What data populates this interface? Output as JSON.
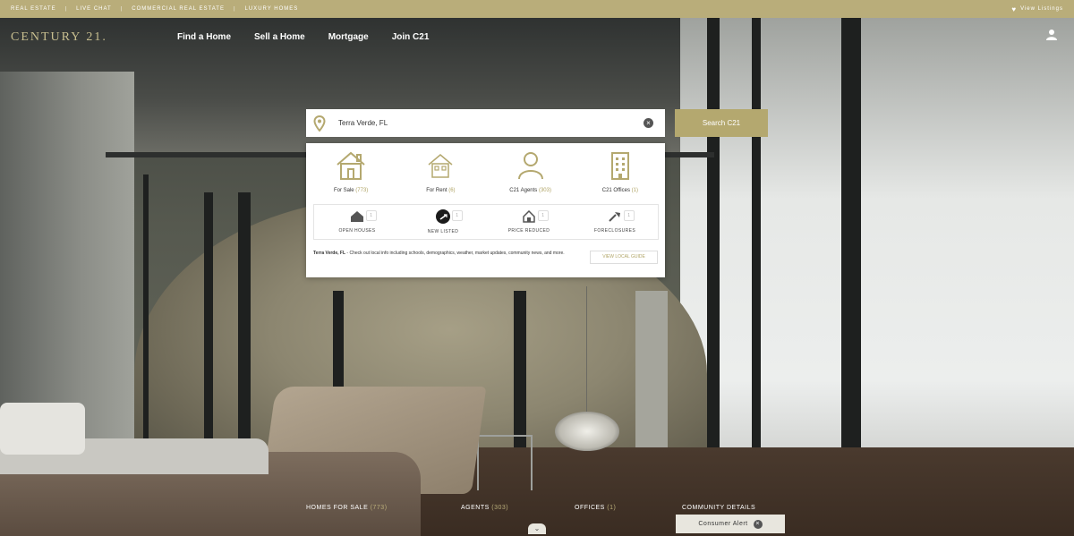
{
  "colors": {
    "accent": "#b9ad7a",
    "button": "#b4a86f",
    "count": "#b0a466"
  },
  "utility": {
    "links": [
      "Real Estate",
      "Live Chat",
      "Commercial Real Estate",
      "Luxury Homes"
    ],
    "view_label": "View Listings"
  },
  "header": {
    "logo": "CENTURY 21.",
    "nav": [
      "Find a Home",
      "Sell a Home",
      "Mortgage",
      "Join C21"
    ]
  },
  "search": {
    "value": "Terra Verde, FL",
    "button_label": "Search C21"
  },
  "categories": [
    {
      "label": "For Sale",
      "count": "(773)",
      "icon": "house-icon"
    },
    {
      "label": "For Rent",
      "count": "(6)",
      "icon": "rental-icon"
    },
    {
      "label": "C21 Agents",
      "count": "(303)",
      "icon": "agent-icon"
    },
    {
      "label": "C21 Offices",
      "count": "(1)",
      "icon": "office-icon"
    }
  ],
  "filters": [
    {
      "label": "Open Houses",
      "badge": "1",
      "icon": "open-house-icon"
    },
    {
      "label": "New Listed",
      "badge": "1",
      "icon": "new-listing-icon"
    },
    {
      "label": "Price Reduced",
      "badge": "1",
      "icon": "price-reduced-icon"
    },
    {
      "label": "Foreclosures",
      "badge": "1",
      "icon": "foreclosure-icon"
    }
  ],
  "description": {
    "place": "Terra Verde, FL",
    "text": " - Check out local info including schools, demographics, weather, market updates, community news, and more."
  },
  "guide_label": "View Local Guide",
  "bottom": {
    "homes_label": "Homes for Sale",
    "homes_count": "(773)",
    "agents_label": "Agents",
    "agents_count": "(303)",
    "offices_label": "Offices",
    "offices_count": "(1)",
    "community_label": "Community Details"
  },
  "alert_label": "Consumer Alert"
}
